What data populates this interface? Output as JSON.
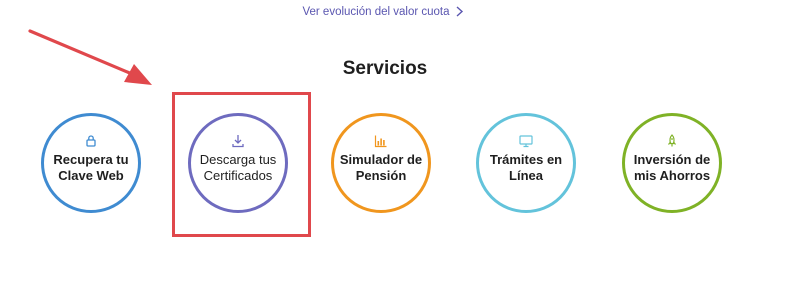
{
  "top_link": {
    "label": "Ver evolución del valor cuota",
    "icon": "chevron-right-icon"
  },
  "section": {
    "title": "Servicios"
  },
  "services": [
    {
      "label": "Recupera tu Clave Web",
      "icon": "lock-icon",
      "color": "#3f8bd1"
    },
    {
      "label": "Descarga tus Certificados",
      "icon": "download-icon",
      "color": "#6e6bbf"
    },
    {
      "label": "Simulador de Pensión",
      "icon": "bar-chart-icon",
      "color": "#f0961e"
    },
    {
      "label": "Trámites en Línea",
      "icon": "monitor-icon",
      "color": "#63c3db"
    },
    {
      "label": "Inversión de mis Ahorros",
      "icon": "rocket-icon",
      "color": "#7fb226"
    }
  ],
  "annotation": {
    "highlight_color": "#e0484c",
    "arrow_color": "#e0484c"
  }
}
